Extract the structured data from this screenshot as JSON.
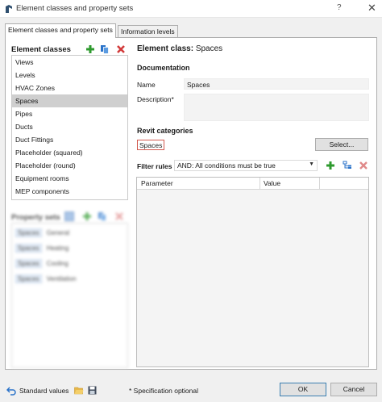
{
  "window": {
    "title": "Element classes and property sets",
    "help": "?",
    "close": "✕"
  },
  "tabs": [
    {
      "label": "Element classes and property sets",
      "active": true
    },
    {
      "label": "Information levels",
      "active": false
    }
  ],
  "element_classes": {
    "heading": "Element classes",
    "items": [
      "Views",
      "Levels",
      "HVAC Zones",
      "Spaces",
      "Pipes",
      "Ducts",
      "Duct Fittings",
      "Placeholder (squared)",
      "Placeholder (round)",
      "Equipment rooms",
      "MEP components"
    ],
    "selected_index": 3
  },
  "property_sets": {
    "heading": "Property sets",
    "rows": [
      {
        "chip": "Spaces",
        "name": "General"
      },
      {
        "chip": "Spaces",
        "name": "Heating"
      },
      {
        "chip": "Spaces",
        "name": "Cooling"
      },
      {
        "chip": "Spaces",
        "name": "Ventilation"
      }
    ]
  },
  "detail": {
    "element_class_label": "Element class:",
    "element_class_value": "Spaces",
    "documentation_heading": "Documentation",
    "name_label": "Name",
    "name_value": "Spaces",
    "description_label": "Description*",
    "description_value": "",
    "revit_heading": "Revit categories",
    "revit_chip": "Spaces",
    "select_button": "Select...",
    "filter_label": "Filter rules",
    "filter_value": "AND: All conditions must be true",
    "grid_columns": [
      "Parameter",
      "Value"
    ]
  },
  "footer": {
    "standard_values": "Standard values",
    "spec_note": "* Specification optional",
    "ok": "OK",
    "cancel": "Cancel"
  },
  "colors": {
    "add": "#2e9a2e",
    "delete": "#d23a3a",
    "copy": "#2b73c9",
    "accent": "#3c7fb1"
  }
}
